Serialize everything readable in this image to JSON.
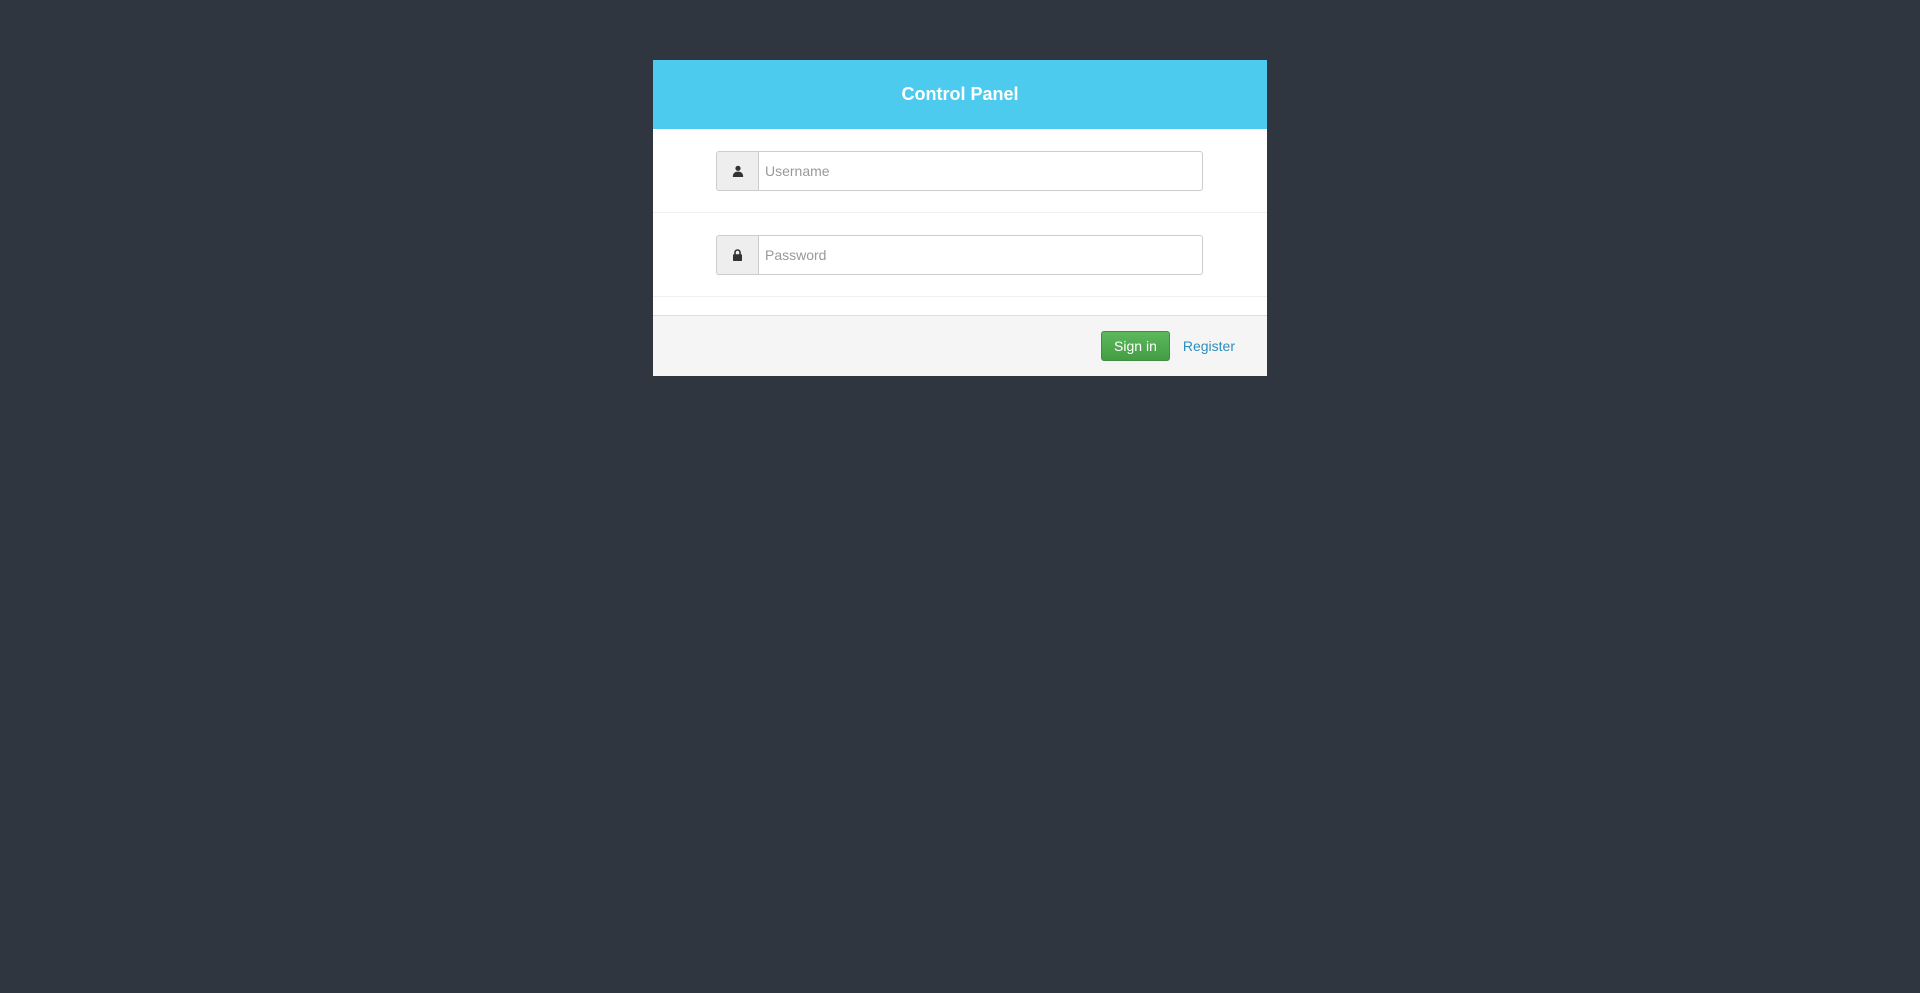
{
  "panel": {
    "title": "Control Panel"
  },
  "form": {
    "username": {
      "placeholder": "Username",
      "icon": "user-icon"
    },
    "password": {
      "placeholder": "Password",
      "icon": "lock-icon"
    }
  },
  "footer": {
    "signin_label": "Sign in",
    "register_label": "Register"
  },
  "colors": {
    "background": "#2f3640",
    "header": "#4dcbef",
    "signin_button": "#5cb85c",
    "link": "#2a8fbd"
  }
}
